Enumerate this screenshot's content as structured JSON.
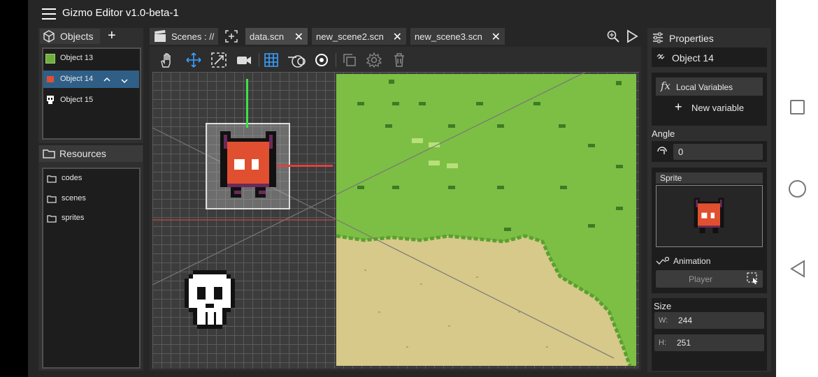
{
  "app": {
    "title": "Gizmo Editor v1.0-beta-1"
  },
  "objects_panel": {
    "header": "Objects",
    "add_label": "+",
    "items": [
      {
        "label": "Object 13"
      },
      {
        "label": "Object 14"
      },
      {
        "label": "Object 15"
      }
    ]
  },
  "resources_panel": {
    "header": "Resources",
    "folders": [
      {
        "label": "codes"
      },
      {
        "label": "scenes"
      },
      {
        "label": "sprites"
      }
    ]
  },
  "scenes": {
    "label": "Scenes : //",
    "tabs": [
      {
        "label": "data.scn"
      },
      {
        "label": "new_scene2.scn"
      },
      {
        "label": "new_scene3.scn"
      }
    ]
  },
  "properties": {
    "header": "Properties",
    "object_name": "Object 14",
    "local_variables_label": "Local Variables",
    "new_variable_label": "New variable",
    "angle_label": "Angle",
    "angle_value": "0",
    "sprite_label": "Sprite",
    "animation_label": "Animation",
    "animation_value": "Player",
    "size_label": "Size",
    "w_label": "W:",
    "w_value": "244",
    "h_label": "H:",
    "h_value": "251"
  },
  "colors": {
    "accent": "#3aa0ff",
    "selected_row": "#2f5f86",
    "grass": "#7cbf44",
    "sand": "#d6c98a",
    "sprite_red": "#e05030"
  }
}
